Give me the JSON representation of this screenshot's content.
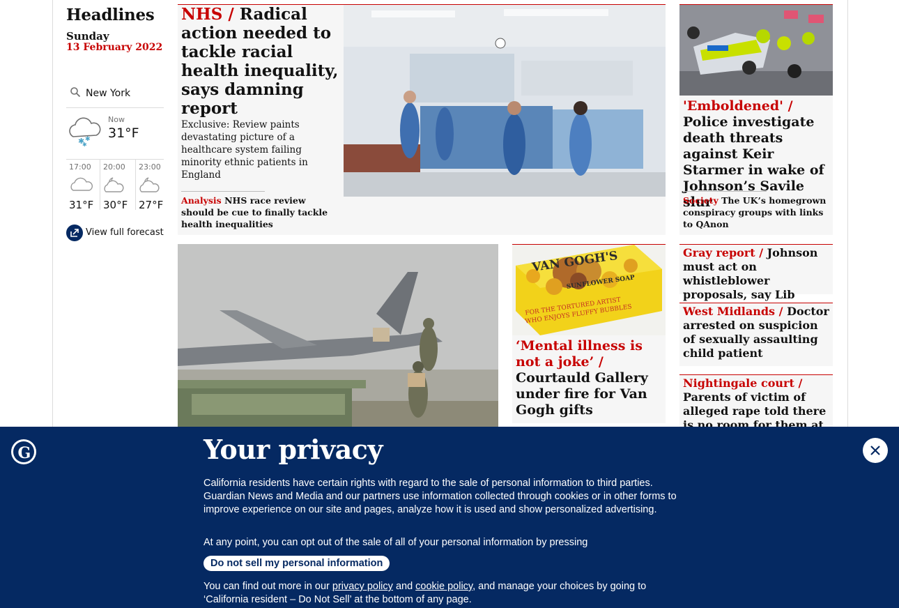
{
  "section": {
    "title": "Headlines",
    "day": "Sunday",
    "date": "13 February 2022"
  },
  "weather": {
    "location": "New York",
    "now_label": "Now",
    "now_temp": "31°F",
    "forecast": [
      {
        "time": "17:00",
        "temp": "31°F",
        "icon": "cloud-icon"
      },
      {
        "time": "20:00",
        "temp": "30°F",
        "icon": "partly-cloudy-night-icon"
      },
      {
        "time": "23:00",
        "temp": "27°F",
        "icon": "partly-cloudy-night-icon"
      }
    ],
    "full_forecast": "View full forecast"
  },
  "lead": {
    "kicker": "NHS /",
    "headline": "Radical action needed to tackle racial health inequality, says damning report",
    "standfirst": "Exclusive: Review paints devastating picture of a healthcare system failing minority ethnic patients in England",
    "sub_kicker": "Analysis",
    "sub_text": "NHS race review should be cue to finally tackle health inequalities"
  },
  "starmer": {
    "kicker": "'Emboldened' /",
    "headline": "Police investigate death threats against Keir Starmer in wake of Johnson’s Savile slur",
    "sub_kicker": "Society",
    "sub_text": "The UK’s homegrown conspiracy groups with links to QAnon"
  },
  "vangogh": {
    "kicker": "‘Mental illness is not a joke’ /",
    "headline": "Courtauld Gallery under fire for Van Gogh gifts",
    "soap_text": [
      "VAN GOGH'S",
      "SUNFLOWER SOAP",
      "FOR THE TORTURED ARTIST",
      "WHO ENJOYS FLUFFY BUBBLES"
    ]
  },
  "small_stories": [
    {
      "kicker": "Gray report /",
      "headline": "Johnson must act on whistleblower proposals, say Lib Dems"
    },
    {
      "kicker": "West Midlands /",
      "headline": "Doctor arrested on suspicion of sexually assaulting child patient"
    },
    {
      "kicker": "Nightingale court /",
      "headline": "Parents of victim of alleged rape told there is no room for them at trial"
    }
  ],
  "privacy": {
    "title": "Your privacy",
    "p1": "California residents have certain rights with regard to the sale of personal information to third parties. Guardian News and Media and our partners use information collected through cookies or in other forms to improve experience on our site and pages, analyze how it is used and show personalized advertising.",
    "p2": "At any point, you can opt out of the sale of all of your personal information by pressing",
    "button": "Do not sell my personal information",
    "p3_a": "You can find out more in our",
    "privacy_link": "privacy policy",
    "p3_b": "and",
    "cookie_link": "cookie policy",
    "p3_c": ", and manage your choices by going to ‘California resident – Do Not Sell’ at the bottom of any page."
  },
  "colors": {
    "kicker": "#c70000",
    "brand": "#052962",
    "card_bg": "#f6f6f6"
  }
}
